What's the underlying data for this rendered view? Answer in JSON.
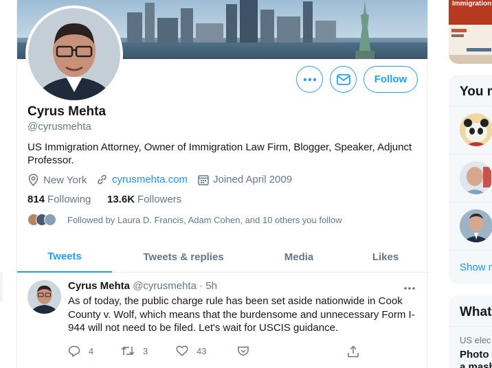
{
  "profile": {
    "name": "Cyrus Mehta",
    "handle": "@cyrusmehta",
    "bio": "US Immigration Attorney, Owner of Immigration Law Firm, Blogger, Speaker, Adjunct Professor.",
    "location": "New York",
    "website": "cyrusmehta.com",
    "joined": "Joined April 2009",
    "following_count": "814",
    "following_label": "Following",
    "followers_count": "13.6K",
    "followers_label": "Followers",
    "followed_by": "Followed by Laura D. Francis, Adam Cohen, and 10 others you follow",
    "follow_button": "Follow"
  },
  "tabs": [
    {
      "label": "Tweets",
      "active": true
    },
    {
      "label": "Tweets & replies",
      "active": false
    },
    {
      "label": "Media",
      "active": false
    },
    {
      "label": "Likes",
      "active": false
    }
  ],
  "tweet": {
    "name": "Cyrus Mehta",
    "handle": "@cyrusmehta",
    "time": "· 5h",
    "text": "As of today, the public charge rule has been set aside nationwide in Cook County v. Wolf, which means that the burdensome and unnecessary Form I-944 will not need to be filed. Let's wait for USCIS guidance.",
    "replies": "4",
    "retweets": "3",
    "likes": "43"
  },
  "sidebar": {
    "promo_text": "Immigration C",
    "who_to_follow_title": "You m",
    "show_more": "Show m",
    "whats_happening_title": "What",
    "trend_category": "US elec",
    "trend_title_line1": "Photo",
    "trend_title_line2": "a mash"
  },
  "colors": {
    "accent": "#1da1f2",
    "link": "#1b95e0",
    "muted": "#657786",
    "border": "#e6ecf0"
  }
}
